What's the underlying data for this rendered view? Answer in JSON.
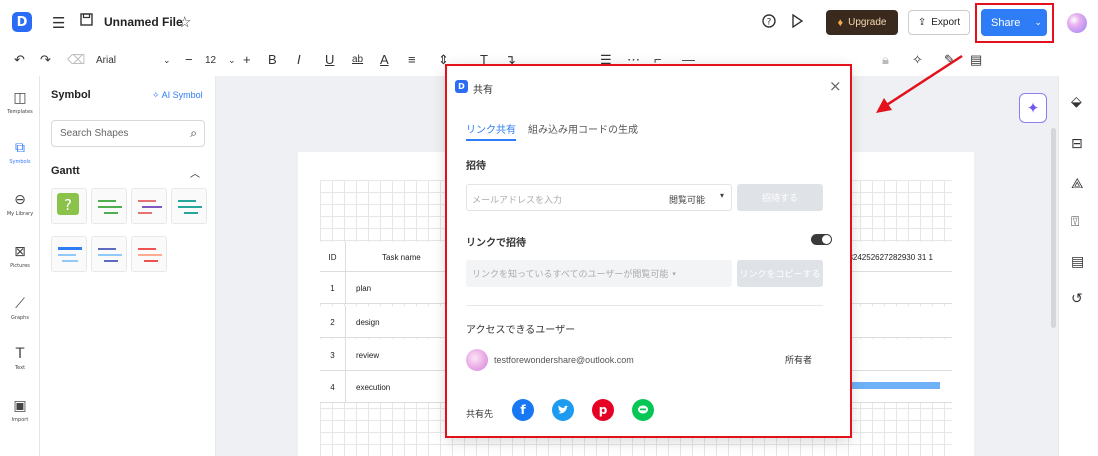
{
  "app": {
    "logo": "D",
    "file_name": "Unnamed File"
  },
  "header": {
    "upgrade": "Upgrade",
    "export": "Export",
    "share": "Share"
  },
  "toolbar": {
    "font": "Arial",
    "font_size": "12"
  },
  "left_rail": [
    {
      "icon": "templates-icon",
      "label": "Templates"
    },
    {
      "icon": "symbols-icon",
      "label": "Symbols"
    },
    {
      "icon": "library-icon",
      "label": "My Library"
    },
    {
      "icon": "pictures-icon",
      "label": "Pictures"
    },
    {
      "icon": "graphs-icon",
      "label": "Graphs"
    },
    {
      "icon": "text-icon",
      "label": "Text"
    },
    {
      "icon": "import-icon",
      "label": "Import"
    }
  ],
  "symbol_panel": {
    "title": "Symbol",
    "ai_symbol": "AI Symbol",
    "search_placeholder": "Search Shapes",
    "category": "Gantt"
  },
  "gantt": {
    "header_id": "ID",
    "header_task": "Task name",
    "day_header": "2324252627282930 31 1",
    "rows": [
      {
        "id": "1",
        "name": "plan"
      },
      {
        "id": "2",
        "name": "design"
      },
      {
        "id": "3",
        "name": "review"
      },
      {
        "id": "4",
        "name": "execution"
      }
    ]
  },
  "dialog": {
    "title": "共有",
    "tab_link": "リンク共有",
    "tab_embed": "組み込み用コードの生成",
    "invite_label": "招待",
    "email_placeholder": "メールアドレスを入力",
    "permission": "閲覧可能",
    "invite_button": "招待する",
    "link_invite_label": "リンクで招待",
    "link_scope": "リンクを知っているすべてのユーザーが閲覧可能",
    "copy_link_button": "リンクをコピーする",
    "access_label": "アクセスできるユーザー",
    "user_email": "testforewondershare@outlook.com",
    "user_role": "所有者",
    "share_to_label": "共有先"
  },
  "colors": {
    "accent": "#2e7cf6",
    "highlight": "#e3111b",
    "upgrade_bg": "#3a2a1e",
    "gantt_bar": "#6eb1f7"
  }
}
